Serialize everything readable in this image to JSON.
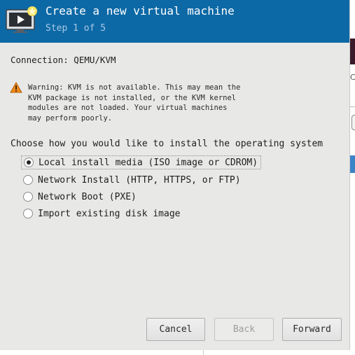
{
  "header": {
    "title": "Create a new virtual machine",
    "step": "Step 1 of 5",
    "icon": "new-vm-monitor-icon"
  },
  "connection": {
    "text": "Connection: QEMU/KVM"
  },
  "warning": {
    "icon": "warning-triangle-icon",
    "lines": [
      "Warning: KVM is not available. This may mean the",
      "KVM package is not installed, or the KVM kernel",
      "modules are not loaded. Your virtual machines",
      "may perform poorly."
    ]
  },
  "install": {
    "prompt": "Choose how you would like to install the operating system",
    "options": [
      {
        "label": "Local install media (ISO image or CDROM)",
        "selected": true
      },
      {
        "label": "Network Install (HTTP, HTTPS, or FTP)",
        "selected": false
      },
      {
        "label": "Network Boot (PXE)",
        "selected": false
      },
      {
        "label": "Import existing disk image",
        "selected": false
      }
    ]
  },
  "buttons": {
    "cancel": "Cancel",
    "back": "Back",
    "forward": "Forward"
  },
  "background": {
    "partial_char": "C"
  },
  "colors": {
    "header_bg": "#0d69a6",
    "dialog_bg": "#e8e8e7",
    "warning": "#e07a10"
  }
}
